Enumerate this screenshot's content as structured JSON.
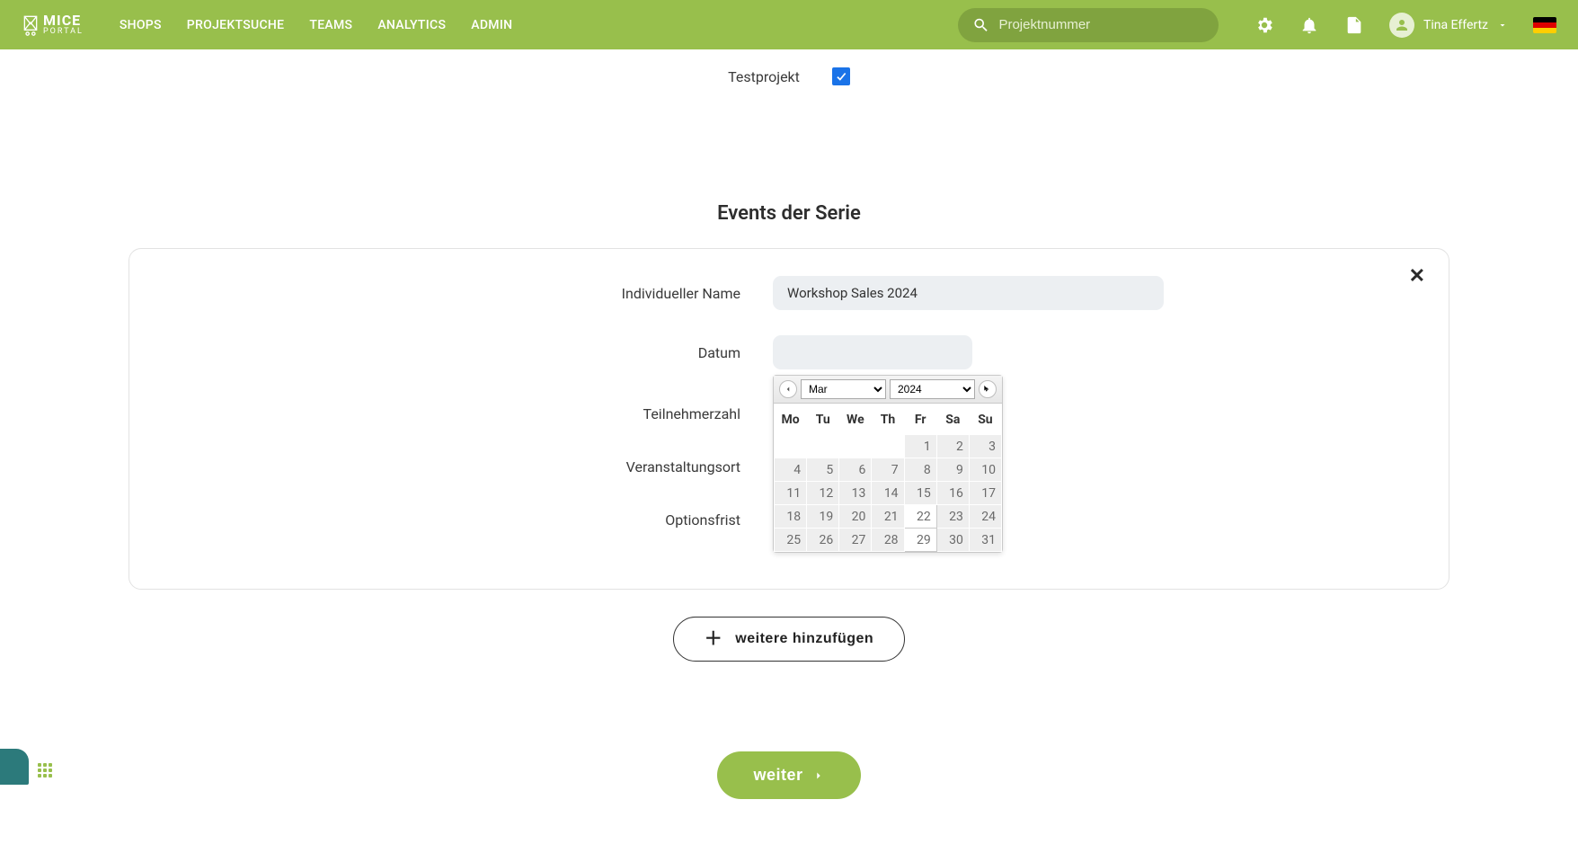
{
  "header": {
    "logo": {
      "big": "MICE",
      "small": "PORTAL"
    },
    "nav": [
      "SHOPS",
      "PROJEKTSUCHE",
      "TEAMS",
      "ANALYTICS",
      "ADMIN"
    ],
    "search": {
      "placeholder": "Projektnummer",
      "value": ""
    },
    "user_name": "Tina Effertz"
  },
  "testprojekt": {
    "label": "Testprojekt",
    "checked": true
  },
  "section_title": "Events der Serie",
  "form": {
    "labels": {
      "name": "Individueller Name",
      "datum": "Datum",
      "teilnehmer": "Teilnehmerzahl",
      "ort": "Veranstaltungsort",
      "option": "Optionsfrist"
    },
    "values": {
      "name": "Workshop Sales 2024",
      "datum": "",
      "teilnehmer": "",
      "ort": "",
      "option": ""
    }
  },
  "datepicker": {
    "month_selected": "Mar",
    "year_selected": "2024",
    "day_headers": [
      "Mo",
      "Tu",
      "We",
      "Th",
      "Fr",
      "Sa",
      "Su"
    ],
    "weeks": [
      [
        "",
        "",
        "",
        "",
        "1",
        "2",
        "3"
      ],
      [
        "4",
        "5",
        "6",
        "7",
        "8",
        "9",
        "10"
      ],
      [
        "11",
        "12",
        "13",
        "14",
        "15",
        "16",
        "17"
      ],
      [
        "18",
        "19",
        "20",
        "21",
        "22",
        "23",
        "24"
      ],
      [
        "25",
        "26",
        "27",
        "28",
        "29",
        "30",
        "31"
      ]
    ],
    "highlight": {
      "week": 3,
      "col": 4
    },
    "today": {
      "week": 4,
      "col": 4
    }
  },
  "buttons": {
    "add_more": "weitere hinzufügen",
    "next": "weiter"
  }
}
